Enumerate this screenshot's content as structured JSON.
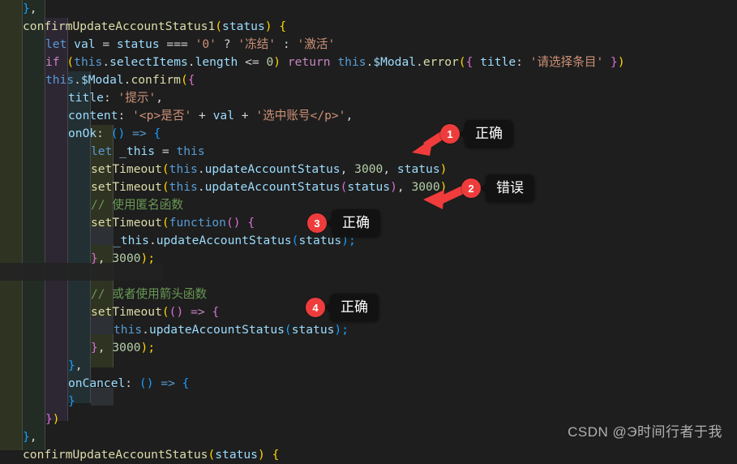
{
  "editor": {
    "background": "#1e1e1e",
    "font_size_px": 14.6,
    "line_height_px": 22,
    "colors": {
      "keyword": "#569cd6",
      "control": "#c586c0",
      "function": "#dcdcaa",
      "variable": "#9cdcfe",
      "string": "#ce9178",
      "number": "#b5cea8",
      "comment": "#6a9955",
      "plain": "#d4d4d4",
      "bracket_level1": "#ffd700",
      "bracket_level2": "#da70d6",
      "bracket_level3": "#179fff",
      "badge_red": "#ee3c3c",
      "bubble_black": "#121212",
      "arrow_red": "#f03c3c"
    },
    "lines": [
      {
        "indent": 1,
        "text": "},"
      },
      {
        "indent": 1,
        "text": "confirmUpdateAccountStatus1(status) {"
      },
      {
        "indent": 2,
        "text": "let val = status === '0' ? '冻结' : '激活'"
      },
      {
        "indent": 2,
        "text": "if (this.selectItems.length <= 0) return this.$Modal.error({ title: '请选择条目' })"
      },
      {
        "indent": 2,
        "text": "this.$Modal.confirm({"
      },
      {
        "indent": 3,
        "text": "title: '提示',"
      },
      {
        "indent": 3,
        "text": "content: '<p>是否' + val + '选中账号</p>',"
      },
      {
        "indent": 3,
        "text": "onOk: () => {"
      },
      {
        "indent": 4,
        "text": "let _this = this"
      },
      {
        "indent": 4,
        "text": "setTimeout(this.updateAccountStatus, 3000, status)"
      },
      {
        "indent": 4,
        "text": "setTimeout(this.updateAccountStatus(status), 3000)"
      },
      {
        "indent": 4,
        "text": "// 使用匿名函数"
      },
      {
        "indent": 4,
        "text": "setTimeout(function() {"
      },
      {
        "indent": 5,
        "text": "_this.updateAccountStatus(status);"
      },
      {
        "indent": 4,
        "text": "}, 3000);"
      },
      {
        "indent": 0,
        "text": ""
      },
      {
        "indent": 4,
        "text": "// 或者使用箭头函数"
      },
      {
        "indent": 4,
        "text": "setTimeout(() => {"
      },
      {
        "indent": 5,
        "text": "this.updateAccountStatus(status);"
      },
      {
        "indent": 4,
        "text": "}, 3000);"
      },
      {
        "indent": 3,
        "text": "},"
      },
      {
        "indent": 3,
        "text": "onCancel: () => {"
      },
      {
        "indent": 3,
        "text": "}"
      },
      {
        "indent": 2,
        "text": "})"
      },
      {
        "indent": 1,
        "text": "},"
      },
      {
        "indent": 1,
        "text": "confirmUpdateAccountStatus(status) {"
      }
    ]
  },
  "annotations": [
    {
      "number": "1",
      "label": "正确",
      "target_line": "setTimeout(this.updateAccountStatus, 3000, status)"
    },
    {
      "number": "2",
      "label": "错误",
      "target_line": "setTimeout(this.updateAccountStatus(status), 3000)"
    },
    {
      "number": "3",
      "label": "正确",
      "target_line": "setTimeout(function() { ... }, 3000);"
    },
    {
      "number": "4",
      "label": "正确",
      "target_line": "setTimeout(() => { ... }, 3000);"
    }
  ],
  "watermark": {
    "text": "CSDN @Э时间行者于我"
  }
}
